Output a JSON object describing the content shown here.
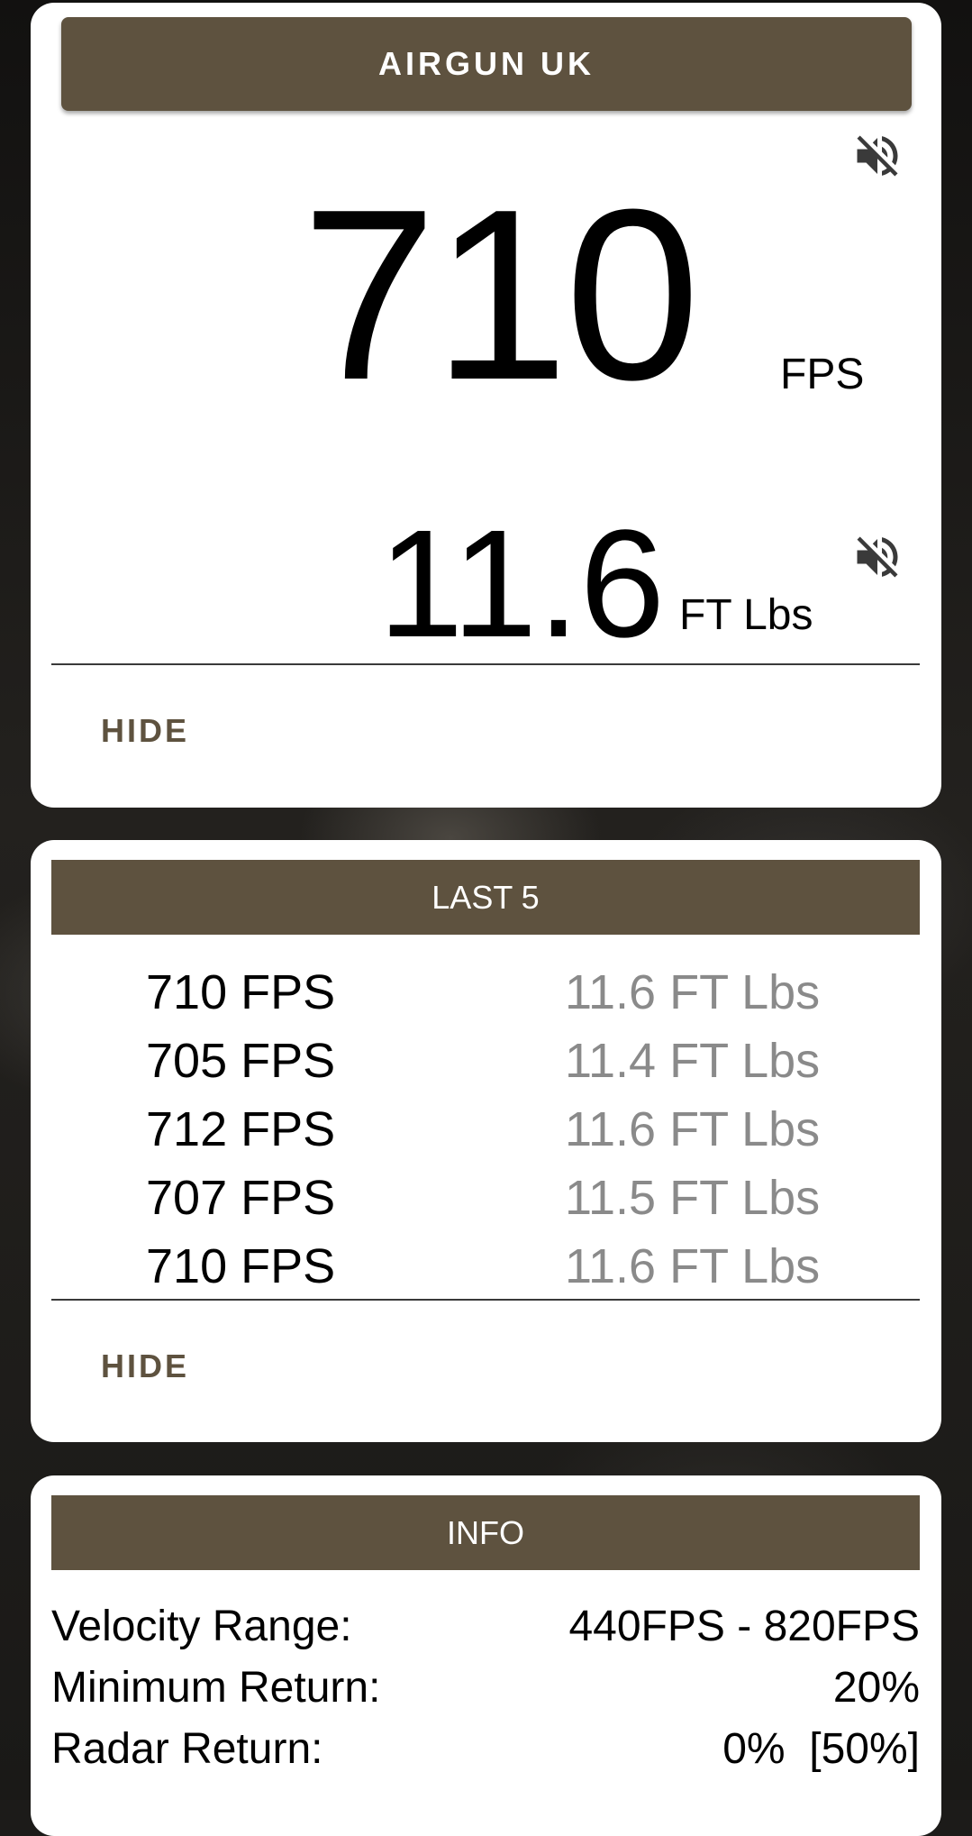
{
  "header": {
    "title": "AIRGUN UK"
  },
  "reading": {
    "velocity": "710",
    "velocity_unit": "FPS",
    "energy": "11.6",
    "energy_unit": "FT Lbs",
    "hide_label": "HIDE"
  },
  "last5": {
    "title": "LAST 5",
    "rows": [
      {
        "fps": "710 FPS",
        "energy": "11.6 FT Lbs"
      },
      {
        "fps": "705 FPS",
        "energy": "11.4 FT Lbs"
      },
      {
        "fps": "712 FPS",
        "energy": "11.6 FT Lbs"
      },
      {
        "fps": "707 FPS",
        "energy": "11.5 FT Lbs"
      },
      {
        "fps": "710 FPS",
        "energy": "11.6 FT Lbs"
      }
    ],
    "hide_label": "HIDE"
  },
  "info": {
    "title": "INFO",
    "rows": [
      {
        "label": "Velocity Range:",
        "value": "440FPS - 820FPS"
      },
      {
        "label": "Minimum Return:",
        "value": "20%"
      },
      {
        "label": "Radar Return:",
        "value": "0%  [50%]"
      }
    ]
  },
  "icons": {
    "mute": "volume-off-icon"
  },
  "colors": {
    "accent": "#5e523f",
    "muted_text": "#8a8a8a"
  }
}
